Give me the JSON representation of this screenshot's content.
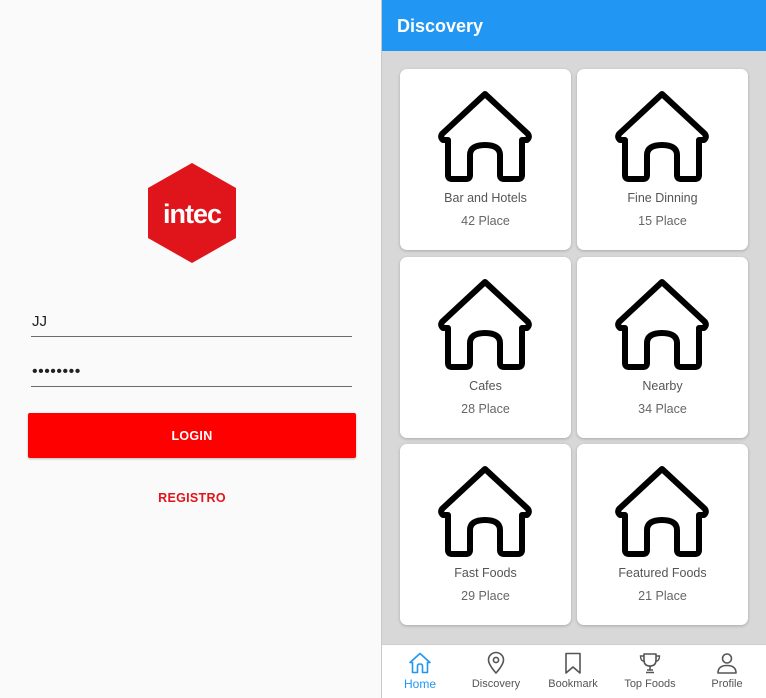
{
  "login": {
    "logo_text": "intec",
    "username_value": "JJ",
    "password_value": "••••••••",
    "login_label": "LOGIN",
    "register_label": "REGISTRO",
    "brand_color": "#e0141b"
  },
  "discovery": {
    "title": "Discovery",
    "accent_color": "#2196f3",
    "cards": [
      {
        "title": "Bar and Hotels",
        "count": "42 Place",
        "icon": "house-icon"
      },
      {
        "title": "Fine Dinning",
        "count": "15 Place",
        "icon": "house-icon"
      },
      {
        "title": "Cafes",
        "count": "28 Place",
        "icon": "house-icon"
      },
      {
        "title": "Nearby",
        "count": "34 Place",
        "icon": "house-icon"
      },
      {
        "title": "Fast Foods",
        "count": "29 Place",
        "icon": "house-icon"
      },
      {
        "title": "Featured Foods",
        "count": "21 Place",
        "icon": "house-icon"
      }
    ],
    "nav": [
      {
        "label": "Home",
        "icon": "home-icon",
        "active": true
      },
      {
        "label": "Discovery",
        "icon": "location-pin-icon",
        "active": false
      },
      {
        "label": "Bookmark",
        "icon": "bookmark-icon",
        "active": false
      },
      {
        "label": "Top Foods",
        "icon": "trophy-icon",
        "active": false
      },
      {
        "label": "Profile",
        "icon": "person-icon",
        "active": false
      }
    ]
  }
}
